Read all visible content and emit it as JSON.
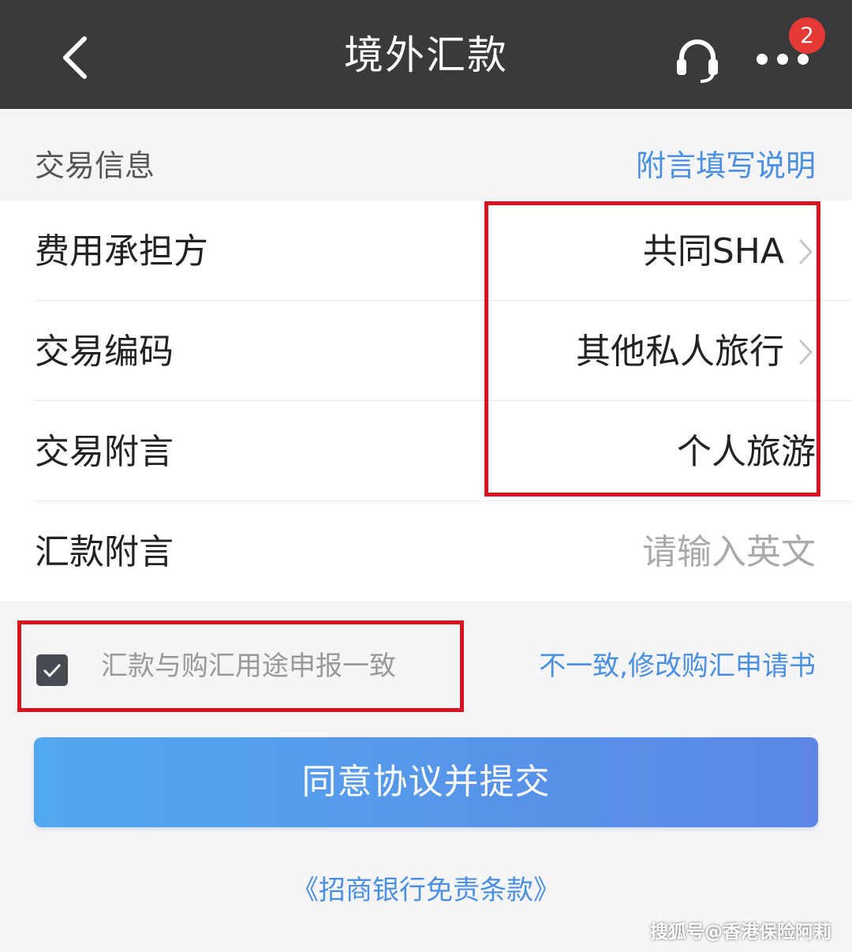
{
  "header": {
    "title": "境外汇款",
    "badge_count": "2",
    "back_icon": "chevron-left-icon",
    "support_icon": "headset-icon",
    "more_icon": "more-dots-icon"
  },
  "section": {
    "title": "交易信息",
    "help_link": "附言填写说明"
  },
  "form": {
    "rows": [
      {
        "label": "费用承担方",
        "value": "共同SHA"
      },
      {
        "label": "交易编码",
        "value": "其他私人旅行"
      },
      {
        "label": "交易附言",
        "value": "个人旅游"
      },
      {
        "label": "汇款附言",
        "placeholder": "请输入英文"
      }
    ]
  },
  "agreement": {
    "checkbox_label": "汇款与购汇用途申报一致",
    "checked": true,
    "modify_link": "不一致,修改购汇申请书"
  },
  "submit_label": "同意协议并提交",
  "terms_link": "《招商银行免责条款》",
  "watermark": "搜狐号@香港保险阿莉",
  "colors": {
    "topbar": "#3a3a3c",
    "link": "#4a90e2",
    "highlight": "#d8151f",
    "button_start": "#52a8ef",
    "button_end": "#5b86e5"
  }
}
